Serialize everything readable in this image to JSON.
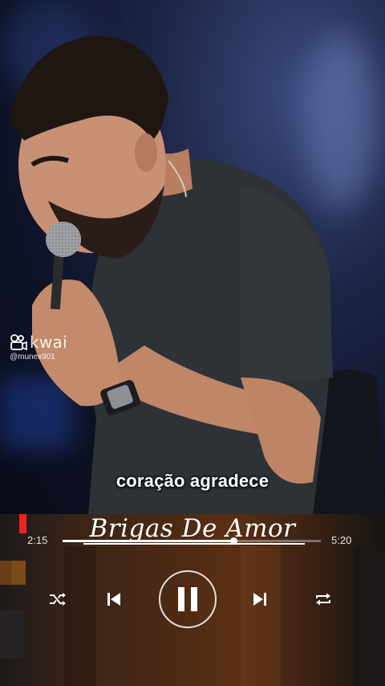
{
  "video": {
    "subtitle": "coração agradece",
    "watermark": {
      "brand": "kwai",
      "username": "@munex901"
    }
  },
  "player": {
    "song_title": "Brigas De Amor",
    "time_elapsed": "2:15",
    "time_total": "5:20",
    "progress_fraction": 0.66,
    "playing": true,
    "controls": {
      "shuffle_icon": "shuffle-icon",
      "prev_icon": "skip-previous-icon",
      "play_icon": "pause-icon",
      "next_icon": "skip-next-icon",
      "repeat_icon": "repeat-icon"
    }
  }
}
